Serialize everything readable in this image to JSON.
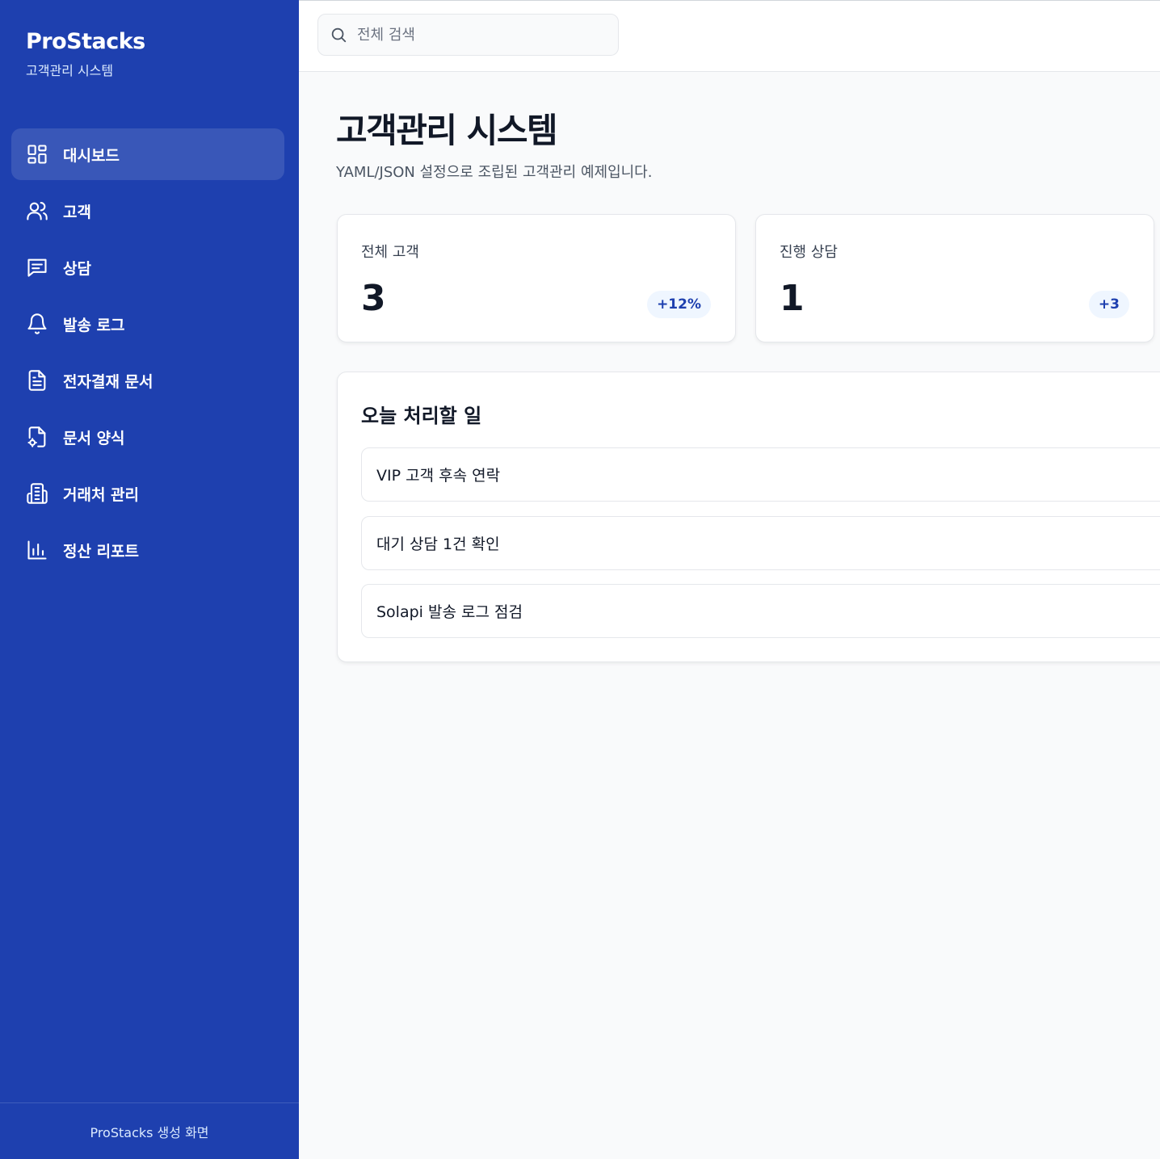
{
  "brand": {
    "title": "ProStacks",
    "subtitle": "고객관리 시스템"
  },
  "sidebar": {
    "items": [
      {
        "label": "대시보드",
        "icon": "dashboard-icon",
        "active": true
      },
      {
        "label": "고객",
        "icon": "users-icon",
        "active": false
      },
      {
        "label": "상담",
        "icon": "message-icon",
        "active": false
      },
      {
        "label": "발송 로그",
        "icon": "bell-icon",
        "active": false
      },
      {
        "label": "전자결재 문서",
        "icon": "document-icon",
        "active": false
      },
      {
        "label": "문서 양식",
        "icon": "document-settings-icon",
        "active": false
      },
      {
        "label": "거래처 관리",
        "icon": "building-icon",
        "active": false
      },
      {
        "label": "정산 리포트",
        "icon": "bar-chart-icon",
        "active": false
      }
    ],
    "footer": "ProStacks 생성 화면"
  },
  "search": {
    "placeholder": "전체 검색"
  },
  "main": {
    "title": "고객관리 시스템",
    "subtitle": "YAML/JSON 설정으로 조립된 고객관리 예제입니다.",
    "stats": [
      {
        "label": "전체 고객",
        "value": "3",
        "badge": "+12%"
      },
      {
        "label": "진행 상담",
        "value": "1",
        "badge": "+3"
      }
    ],
    "tasks": {
      "title": "오늘 처리할 일",
      "items": [
        "VIP 고객 후속 연락",
        "대기 상담 1건 확인",
        "Solapi 발송 로그 점검"
      ]
    }
  },
  "colors": {
    "sidebar_bg": "#1e40af",
    "badge_bg": "#eff6ff",
    "badge_text": "#1e40af"
  }
}
